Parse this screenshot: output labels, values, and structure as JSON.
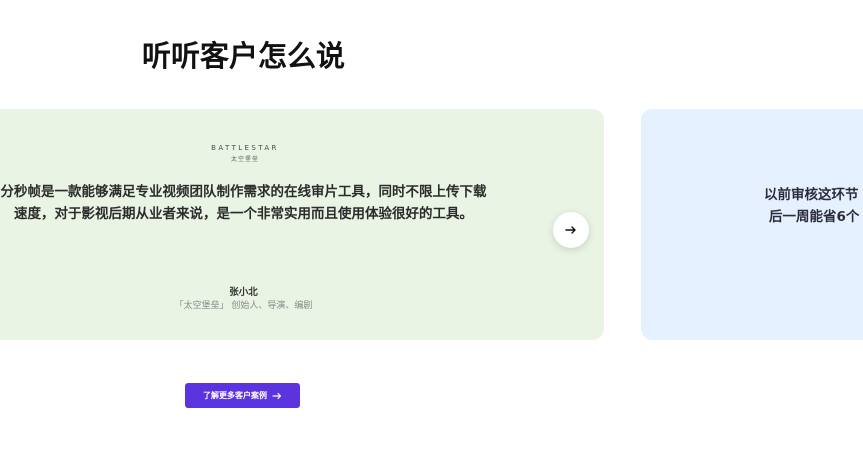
{
  "section": {
    "title": "听听客户怎么说"
  },
  "testimonials": [
    {
      "logo_text": "BATTLESTAR",
      "logo_subtext": "太空堡垒",
      "quote": "分秒帧是一款能够满足专业视频团队制作需求的在线审片工具，同时不限上传下载速度，对于影视后期从业者来说，是一个非常实用而且使用体验很好的工具。",
      "author_name": "张小北",
      "author_role": "「太空堡垒」 创始人、导演、编剧",
      "background_color": "#eaf4e4"
    },
    {
      "quote_line1": "以前审核这环节",
      "quote_line2": "后一周能省6个",
      "background_color": "#e6f1ff"
    }
  ],
  "carousel": {
    "next_icon": "arrow-right-icon"
  },
  "cta": {
    "label": "了解更多客户案例",
    "icon": "arrow-right-icon",
    "color": "#5b34e0"
  }
}
